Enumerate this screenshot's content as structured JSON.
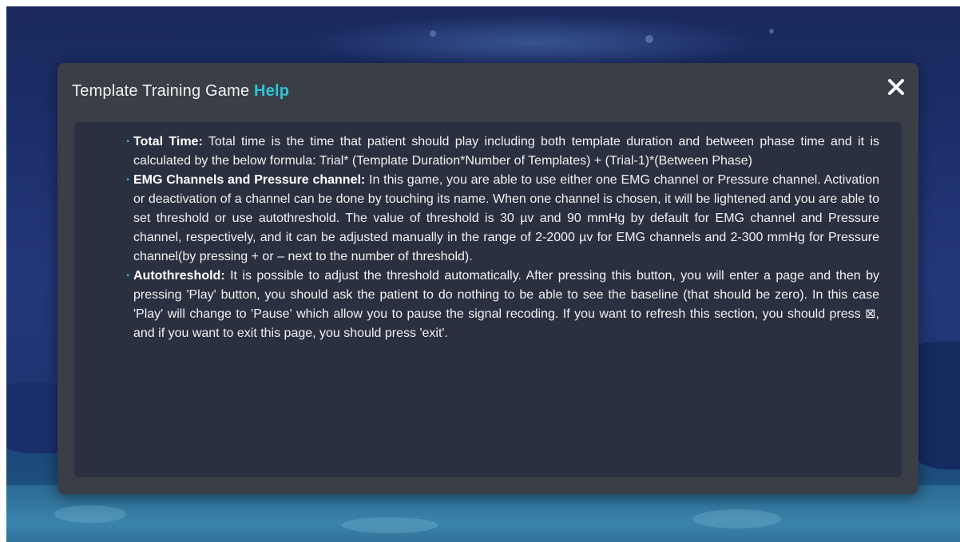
{
  "dialog": {
    "title_main": "Template Training Game",
    "title_accent": "Help",
    "close_icon": "close-x-icon"
  },
  "help_items": [
    {
      "term": "Total Time:",
      "text": " Total time is the time that patient should play including both template duration and between phase time and it is calculated by the below formula: Trial* (Template Duration*Number of Templates) + (Trial-1)*(Between Phase)"
    },
    {
      "term": "EMG Channels and Pressure channel:",
      "text": " In this game, you are able to use either one EMG channel or Pressure channel. Activation or deactivation of a channel can be done by touching its name. When one channel is chosen, it will be lightened and you are able to set threshold or use autothreshold. The value of threshold is 30 µv and 90 mmHg by default for EMG channel and Pressure channel, respectively, and it can be adjusted manually in the range of 2-2000 µv for EMG channels and 2-300 mmHg for Pressure channel(by pressing + or – next to the number of threshold)."
    },
    {
      "term": "Autothreshold:",
      "text": " It is possible to adjust the threshold automatically. After pressing this button, you will enter a page and then by pressing 'Play' button, you should ask the patient to do nothing to be able to see the baseline (that should be zero). In this case 'Play' will change to 'Pause' which allow you to pause the signal recoding. If you want to refresh this section, you should press ⊠, and if you want to exit this page, you should press 'exit'."
    }
  ],
  "colors": {
    "accent": "#2ec4d6",
    "dialog_bg": "#3a3e46",
    "content_bg": "#2b3040",
    "text": "#f1f1f1"
  }
}
